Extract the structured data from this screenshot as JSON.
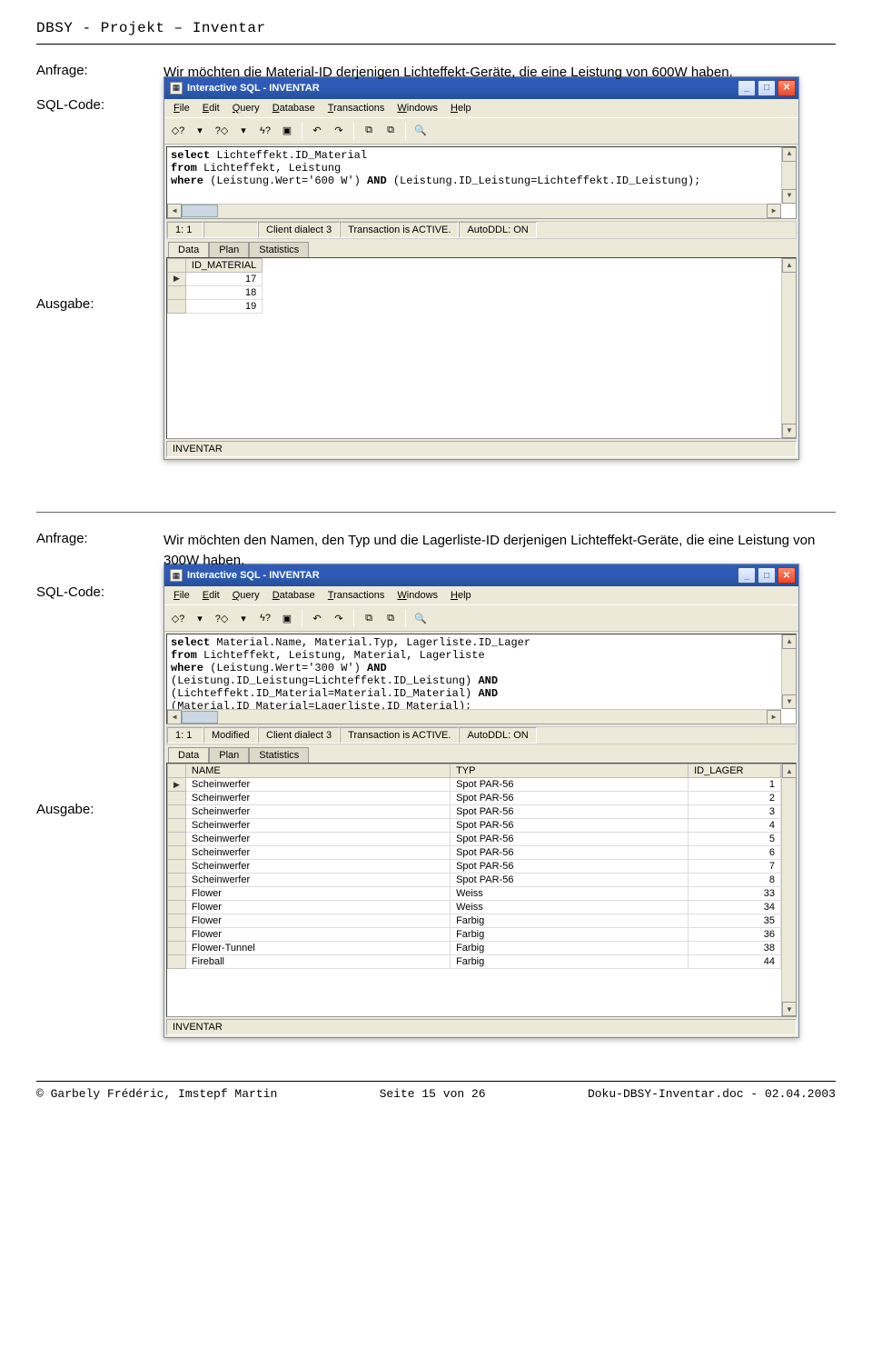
{
  "header": "DBSY - Projekt – Inventar",
  "labels": {
    "anfrage": "Anfrage:",
    "sqlcode": "SQL-Code:",
    "ausgabe": "Ausgabe:"
  },
  "query1": {
    "desc": "Wir möchten die Material-ID derjenigen Lichteffekt-Geräte, die eine Leistung von 600W haben.",
    "window_title": "Interactive SQL  - INVENTAR",
    "menus": [
      "File",
      "Edit",
      "Query",
      "Database",
      "Transactions",
      "Windows",
      "Help"
    ],
    "sql_lines": [
      {
        "pre": "",
        "kw": "select",
        "post": " Lichteffekt.ID_Material"
      },
      {
        "pre": "",
        "kw": "from",
        "post": " Lichteffekt, Leistung"
      },
      {
        "pre": "",
        "kw": "where",
        "post": " (Leistung.Wert='600 W') ",
        "kw2": "AND",
        "post2": " (Leistung.ID_Leistung=Lichteffekt.ID_Leistung);"
      }
    ],
    "status": [
      "1: 1",
      "",
      "Client dialect 3",
      "Transaction is ACTIVE.",
      "AutoDDL: ON"
    ],
    "tabs": [
      "Data",
      "Plan",
      "Statistics"
    ],
    "result_header": "ID_MATERIAL",
    "result_rows": [
      17,
      18,
      19
    ],
    "footer_db": "INVENTAR"
  },
  "query2": {
    "desc": "Wir möchten den Namen, den Typ und die Lagerliste-ID derjenigen Lichteffekt-Geräte, die eine Leistung von 300W haben.",
    "window_title": "Interactive SQL  - INVENTAR",
    "menus": [
      "File",
      "Edit",
      "Query",
      "Database",
      "Transactions",
      "Windows",
      "Help"
    ],
    "sql_lines": [
      {
        "pre": "",
        "kw": "select",
        "post": " Material.Name, Material.Typ, Lagerliste.ID_Lager"
      },
      {
        "pre": "",
        "kw": "from",
        "post": " Lichteffekt, Leistung, Material, Lagerliste"
      },
      {
        "pre": "",
        "kw": "where",
        "post": "  (Leistung.Wert='300 W') ",
        "kw2": "AND",
        "post2": ""
      },
      {
        "pre": "       (Leistung.ID_Leistung=Lichteffekt.ID_Leistung) ",
        "kw": "AND",
        "post": ""
      },
      {
        "pre": "       (Lichteffekt.ID_Material=Material.ID_Material) ",
        "kw": "AND",
        "post": ""
      },
      {
        "pre": "       (Material.ID_Material=Lagerliste.ID_Material);",
        "kw": "",
        "post": ""
      }
    ],
    "status": [
      "1: 1",
      "Modified",
      "Client dialect 3",
      "Transaction is ACTIVE.",
      "AutoDDL: ON"
    ],
    "tabs": [
      "Data",
      "Plan",
      "Statistics"
    ],
    "result_headers": [
      "NAME",
      "TYP",
      "ID_LAGER"
    ],
    "result_rows": [
      [
        "Scheinwerfer",
        "Spot PAR-56",
        1
      ],
      [
        "Scheinwerfer",
        "Spot PAR-56",
        2
      ],
      [
        "Scheinwerfer",
        "Spot PAR-56",
        3
      ],
      [
        "Scheinwerfer",
        "Spot PAR-56",
        4
      ],
      [
        "Scheinwerfer",
        "Spot PAR-56",
        5
      ],
      [
        "Scheinwerfer",
        "Spot PAR-56",
        6
      ],
      [
        "Scheinwerfer",
        "Spot PAR-56",
        7
      ],
      [
        "Scheinwerfer",
        "Spot PAR-56",
        8
      ],
      [
        "Flower",
        "Weiss",
        33
      ],
      [
        "Flower",
        "Weiss",
        34
      ],
      [
        "Flower",
        "Farbig",
        35
      ],
      [
        "Flower",
        "Farbig",
        36
      ],
      [
        "Flower-Tunnel",
        "Farbig",
        38
      ],
      [
        "Fireball",
        "Farbig",
        44
      ]
    ],
    "footer_db": "INVENTAR"
  },
  "footer": {
    "left": "© Garbely Frédéric, Imstepf Martin",
    "center": "Seite 15 von 26",
    "right": "Doku-DBSY-Inventar.doc - 02.04.2003"
  },
  "toolbar_icons": [
    "query-prev-icon",
    "dropdown-icon",
    "query-next-icon",
    "dropdown-icon",
    "run-icon",
    "stop-icon",
    "sep",
    "undo-icon",
    "redo-icon",
    "sep",
    "copy-icon",
    "paste-icon",
    "sep",
    "find-icon"
  ]
}
